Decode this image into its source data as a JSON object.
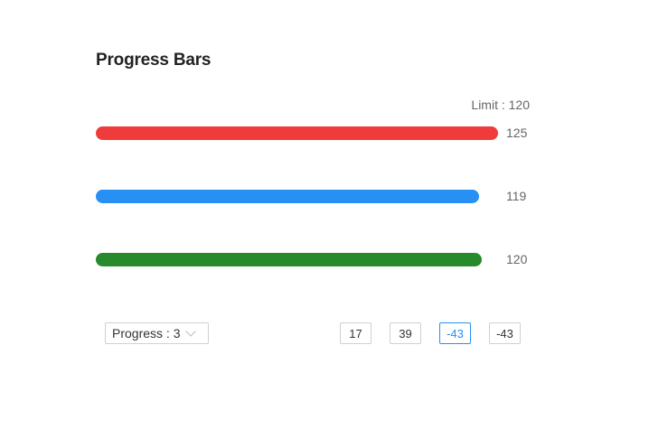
{
  "header": {
    "title": "Progress Bars"
  },
  "limit_label": "Limit : 120",
  "limit": 120,
  "bars": [
    {
      "value": 125,
      "label": "125",
      "color": "#ef3b3b"
    },
    {
      "value": 119,
      "label": "119",
      "color": "#2690f5"
    },
    {
      "value": 120,
      "label": "120",
      "color": "#278a2b"
    }
  ],
  "controls": {
    "select_label": "Progress : 3",
    "buttons": [
      {
        "label": "17",
        "active": false
      },
      {
        "label": "39",
        "active": false
      },
      {
        "label": "-43",
        "active": true
      },
      {
        "label": "-43",
        "active": false
      }
    ]
  }
}
